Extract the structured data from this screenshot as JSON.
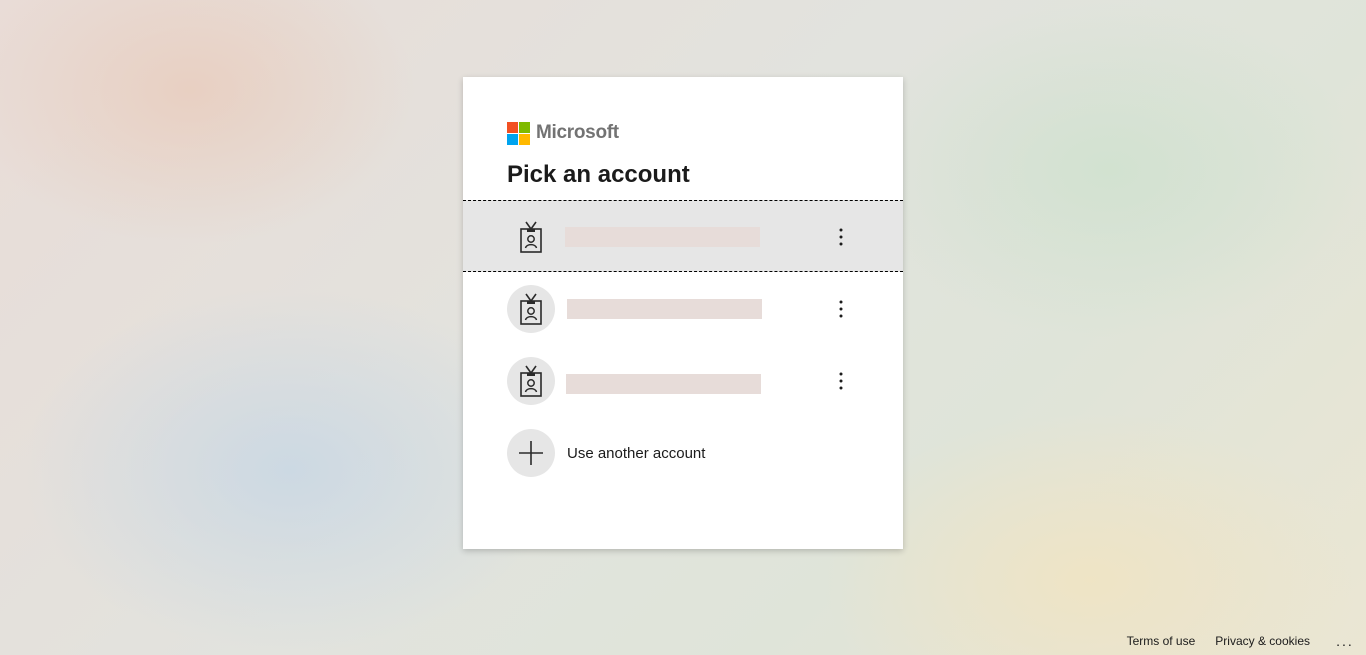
{
  "brand": {
    "name": "Microsoft",
    "logo_colors": [
      "#f25022",
      "#7fba00",
      "#00a4ef",
      "#ffb900"
    ]
  },
  "title": "Pick an account",
  "accounts": [
    {
      "icon": "badge-person-icon",
      "selected": true
    },
    {
      "icon": "badge-person-icon",
      "selected": false
    },
    {
      "icon": "badge-person-icon",
      "selected": false
    }
  ],
  "use_another": {
    "label": "Use another account",
    "icon": "plus-icon"
  },
  "footer": {
    "terms": "Terms of use",
    "privacy": "Privacy & cookies",
    "more": "..."
  }
}
